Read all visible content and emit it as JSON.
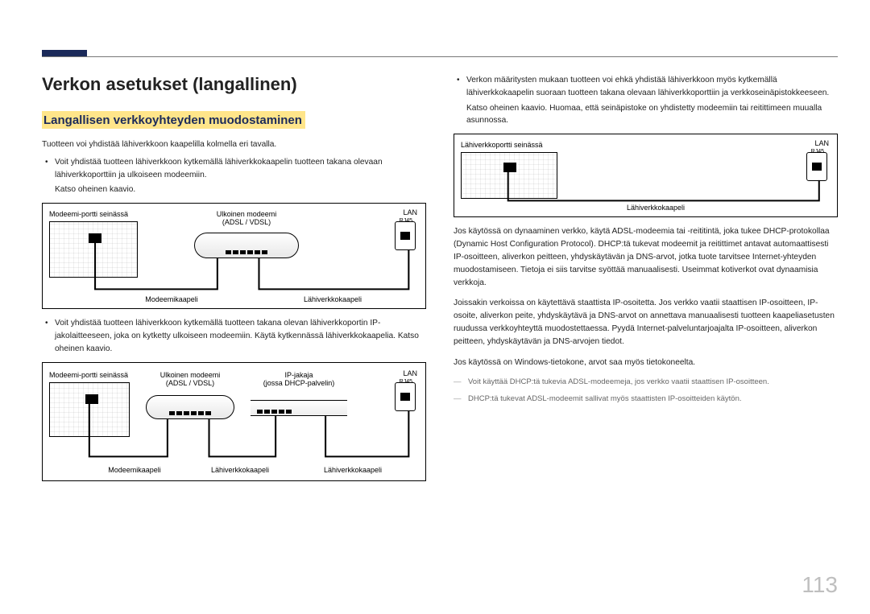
{
  "page_number": "113",
  "heading": "Verkon asetukset (langallinen)",
  "subheading": "Langallisen verkkoyhteyden muodostaminen",
  "intro": "Tuotteen voi yhdistää lähiverkkoon kaapelilla kolmella eri tavalla.",
  "left_bullets": [
    {
      "text": "Voit yhdistää tuotteen lähiverkkoon kytkemällä lähiverkkokaapelin tuotteen takana olevaan lähiverkkoporttiin ja ulkoiseen modeemiin.",
      "sub": "Katso oheinen kaavio."
    },
    {
      "text": "Voit yhdistää tuotteen lähiverkkoon kytkemällä tuotteen takana olevan lähiverkkoportin IP-jakolaitteeseen, joka on kytketty ulkoiseen modeemiin. Käytä kytkennässä lähiverkkokaapelia. Katso oheinen kaavio."
    }
  ],
  "right_bullet": {
    "text": "Verkon määritysten mukaan tuotteen voi ehkä yhdistää lähiverkkoon myös kytkemällä lähiverkkokaapelin suoraan tuotteen takana olevaan lähiverkkoporttiin ja verkkoseinäpistokkeeseen.",
    "sub": "Katso oheinen kaavio. Huomaa, että seinäpistoke on yhdistetty modeemiin tai reitittimeen muualla asunnossa."
  },
  "right_paras": [
    "Jos käytössä on dynaaminen verkko, käytä ADSL-modeemia tai -reititintä, joka tukee DHCP-protokollaa (Dynamic Host Configuration Protocol). DHCP:tä tukevat modeemit ja reitittimet antavat automaattisesti IP-osoitteen, aliverkon peitteen, yhdyskäytävän ja DNS-arvot, jotka tuote tarvitsee Internet-yhteyden muodostamiseen. Tietoja ei siis tarvitse syöttää manuaalisesti. Useimmat kotiverkot ovat dynaamisia verkkoja.",
    "Joissakin verkoissa on käytettävä staattista IP-osoitetta. Jos verkko vaatii staattisen IP-osoitteen, IP-osoite, aliverkon peite, yhdyskäytävä ja DNS-arvot on annettava manuaalisesti tuotteen kaapeliasetusten ruudussa verkkoyhteyttä muodostettaessa. Pyydä Internet-palveluntarjoajalta IP-osoitteen, aliverkon peitteen, yhdyskäytävän ja DNS-arvojen tiedot.",
    "Jos käytössä on Windows-tietokone, arvot saa myös tietokoneelta."
  ],
  "dash_notes": [
    "Voit käyttää DHCP:tä tukevia ADSL-modeemeja, jos verkko vaatii staattisen IP-osoitteen.",
    "DHCP:tä tukevat ADSL-modeemit sallivat myös staattisten IP-osoitteiden käytön."
  ],
  "diagram1": {
    "wall_label": "Modeemi-portti seinässä",
    "modem_label_top": "Ulkoinen modeemi",
    "modem_label_bottom": "(ADSL / VDSL)",
    "lan_label": "LAN",
    "rj45": "RJ45",
    "cable1": "Modeemikaapeli",
    "cable2": "Lähiverkkokaapeli"
  },
  "diagram2": {
    "wall_label": "Modeemi-portti seinässä",
    "modem_label_top": "Ulkoinen modeemi",
    "modem_label_bottom": "(ADSL / VDSL)",
    "router_label_top": "IP-jakaja",
    "router_label_bottom": "(jossa DHCP-palvelin)",
    "lan_label": "LAN",
    "rj45": "RJ45",
    "cable1": "Modeemikaapeli",
    "cable2": "Lähiverkkokaapeli",
    "cable3": "Lähiverkkokaapeli"
  },
  "diagram3": {
    "wall_label": "Lähiverkkoportti seinässä",
    "lan_label": "LAN",
    "rj45": "RJ45",
    "cable1": "Lähiverkkokaapeli"
  }
}
